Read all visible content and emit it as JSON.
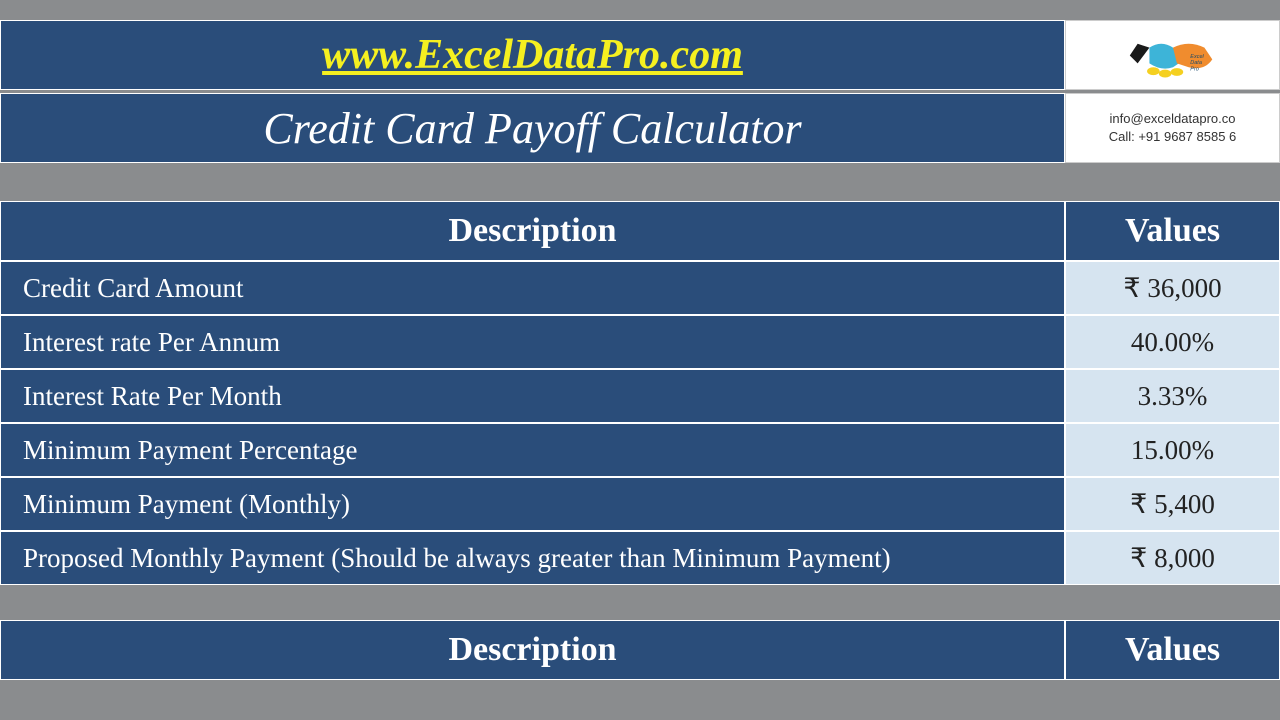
{
  "header": {
    "url": "www.ExcelDataPro.com",
    "title": "Credit Card Payoff Calculator",
    "contact_email": "info@exceldatapro.co",
    "contact_phone": "Call: +91 9687 8585 6"
  },
  "table1": {
    "header_desc": "Description",
    "header_val": "Values",
    "rows": [
      {
        "desc": "Credit Card Amount",
        "val": "₹ 36,000"
      },
      {
        "desc": "Interest rate Per Annum",
        "val": "40.00%"
      },
      {
        "desc": "Interest Rate Per Month",
        "val": "3.33%"
      },
      {
        "desc": "Minimum Payment Percentage",
        "val": "15.00%"
      },
      {
        "desc": "Minimum Payment (Monthly)",
        "val": "₹ 5,400"
      },
      {
        "desc": "Proposed Monthly Payment (Should be always greater than Minimum Payment)",
        "val": "₹ 8,000"
      }
    ]
  },
  "table2": {
    "header_desc": "Description",
    "header_val": "Values"
  }
}
